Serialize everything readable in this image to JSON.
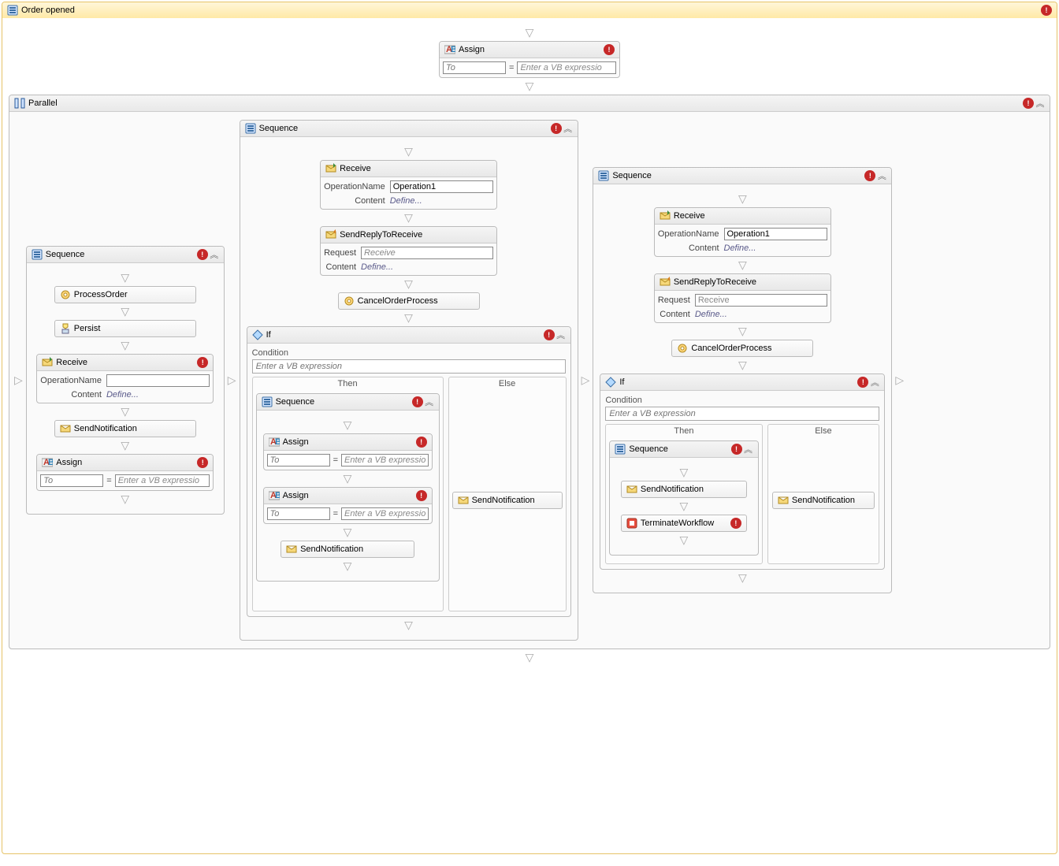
{
  "root": {
    "title": "Order opened"
  },
  "top_assign": {
    "title": "Assign",
    "to_ph": "To",
    "expr_ph": "Enter a VB expressio"
  },
  "parallel": {
    "title": "Parallel"
  },
  "seq1": {
    "title": "Sequence",
    "process_order": "ProcessOrder",
    "persist": "Persist",
    "receive": {
      "title": "Receive",
      "op_label": "OperationName",
      "op_value": "",
      "content_label": "Content",
      "content_link": "Define..."
    },
    "send_notif": "SendNotification",
    "assign": {
      "title": "Assign",
      "to_ph": "To",
      "expr_ph": "Enter a VB expressio"
    }
  },
  "seq2": {
    "title": "Sequence",
    "receive": {
      "title": "Receive",
      "op_label": "OperationName",
      "op_value": "Operation1",
      "content_label": "Content",
      "content_link": "Define..."
    },
    "reply": {
      "title": "SendReplyToReceive",
      "req_label": "Request",
      "req_value": "Receive",
      "content_label": "Content",
      "content_link": "Define..."
    },
    "cancel": "CancelOrderProcess",
    "ifblock": {
      "title": "If",
      "cond_label": "Condition",
      "cond_ph": "Enter a VB expression",
      "then_label": "Then",
      "else_label": "Else",
      "then_seq": "Sequence",
      "assign1": {
        "title": "Assign",
        "to_ph": "To",
        "expr_ph": "Enter a VB expressio"
      },
      "assign2": {
        "title": "Assign",
        "to_ph": "To",
        "expr_ph": "Enter a VB expressio"
      },
      "then_send": "SendNotification",
      "else_send": "SendNotification"
    }
  },
  "seq3": {
    "title": "Sequence",
    "receive": {
      "title": "Receive",
      "op_label": "OperationName",
      "op_value": "Operation1",
      "content_label": "Content",
      "content_link": "Define..."
    },
    "reply": {
      "title": "SendReplyToReceive",
      "req_label": "Request",
      "req_value": "Receive",
      "content_label": "Content",
      "content_link": "Define..."
    },
    "cancel": "CancelOrderProcess",
    "ifblock": {
      "title": "If",
      "cond_label": "Condition",
      "cond_ph": "Enter a VB expression",
      "then_label": "Then",
      "else_label": "Else",
      "then_seq": "Sequence",
      "then_send": "SendNotification",
      "terminate": "TerminateWorkflow",
      "else_send": "SendNotification"
    }
  }
}
